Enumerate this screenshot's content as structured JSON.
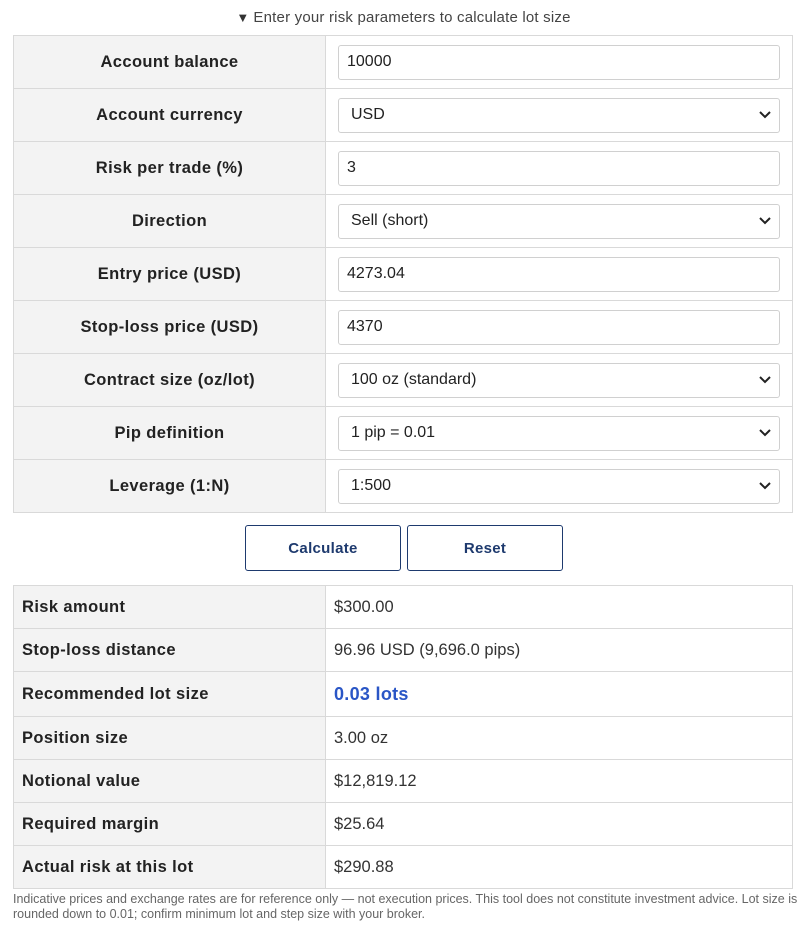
{
  "summary": {
    "arrow": "▼",
    "text": "Enter your risk parameters to calculate lot size"
  },
  "form": {
    "account_balance": {
      "label": "Account balance",
      "value": "10000"
    },
    "account_currency": {
      "label": "Account currency",
      "value": "USD"
    },
    "risk_per_trade": {
      "label": "Risk per trade (%)",
      "value": "3"
    },
    "direction": {
      "label": "Direction",
      "value": "Sell (short)"
    },
    "entry_price": {
      "label": "Entry price (USD)",
      "value": "4273.04"
    },
    "stop_loss_price": {
      "label": "Stop-loss price (USD)",
      "value": "4370"
    },
    "contract_size": {
      "label": "Contract size (oz/lot)",
      "value": "100 oz (standard)"
    },
    "pip_definition": {
      "label": "Pip definition",
      "value": "1 pip = 0.01"
    },
    "leverage": {
      "label": "Leverage (1:N)",
      "value": "1:500"
    }
  },
  "buttons": {
    "calculate": "Calculate",
    "reset": "Reset"
  },
  "results": {
    "risk_amount": {
      "label": "Risk amount",
      "value": "$300.00"
    },
    "stop_loss_distance": {
      "label": "Stop-loss distance",
      "value": "96.96 USD (9,696.0 pips)"
    },
    "recommended_lot": {
      "label": "Recommended lot size",
      "value": "0.03 lots"
    },
    "position_size": {
      "label": "Position size",
      "value": "3.00 oz"
    },
    "notional_value": {
      "label": "Notional value",
      "value": "$12,819.12"
    },
    "required_margin": {
      "label": "Required margin",
      "value": "$25.64"
    },
    "actual_risk": {
      "label": "Actual risk at this lot",
      "value": "$290.88"
    }
  },
  "disclaimer": "Indicative prices and exchange rates are for reference only — not execution prices. This tool does not constitute investment advice. Lot size is rounded down to 0.01; confirm minimum lot and step size with your broker.",
  "colors": {
    "accent": "#2a56c6",
    "button_border": "#1e3a6e",
    "label_bg": "#f3f3f3",
    "border": "#d9d9d9"
  },
  "icons": {
    "summary": "triangle-down-icon",
    "select": "chevron-down-icon"
  }
}
